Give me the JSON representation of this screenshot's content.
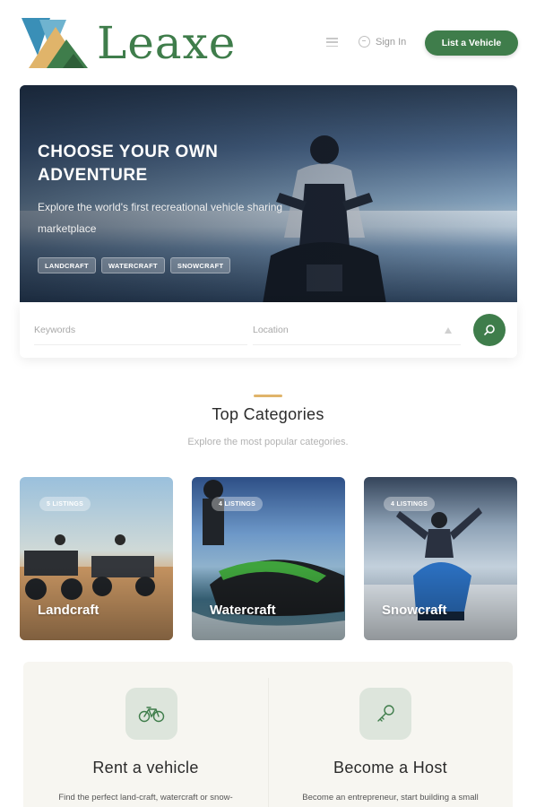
{
  "header": {
    "brand": "Leaxe",
    "menu_icon": "hamburger-icon",
    "signin_label": "Sign In",
    "signin_icon": "sign-in-icon",
    "list_vehicle_label": "List a Vehicle"
  },
  "hero": {
    "title": "CHOOSE YOUR OWN ADVENTURE",
    "subtitle": "Explore the world's first recreational vehicle sharing marketplace",
    "chips": [
      "LANDCRAFT",
      "WATERCRAFT",
      "SNOWCRAFT"
    ]
  },
  "search": {
    "keywords_placeholder": "Keywords",
    "location_placeholder": "Location",
    "search_icon": "search-icon"
  },
  "categories": {
    "title": "Top Categories",
    "subtitle": "Explore the most popular categories.",
    "items": [
      {
        "name": "Landcraft",
        "badge": "5 LISTINGS"
      },
      {
        "name": "Watercraft",
        "badge": "4 LISTINGS"
      },
      {
        "name": "Snowcraft",
        "badge": "4 LISTINGS"
      }
    ]
  },
  "info": {
    "rent": {
      "icon": "bicycle-icon",
      "title": "Rent a vehicle",
      "description": "Find the perfect land-craft, watercraft or snow-"
    },
    "host": {
      "icon": "key-icon",
      "title": "Become a Host",
      "description": "Become an entrepreneur, start building a small"
    }
  },
  "colors": {
    "brand_green": "#3f7d4b",
    "accent_gold": "#e0b46a"
  }
}
